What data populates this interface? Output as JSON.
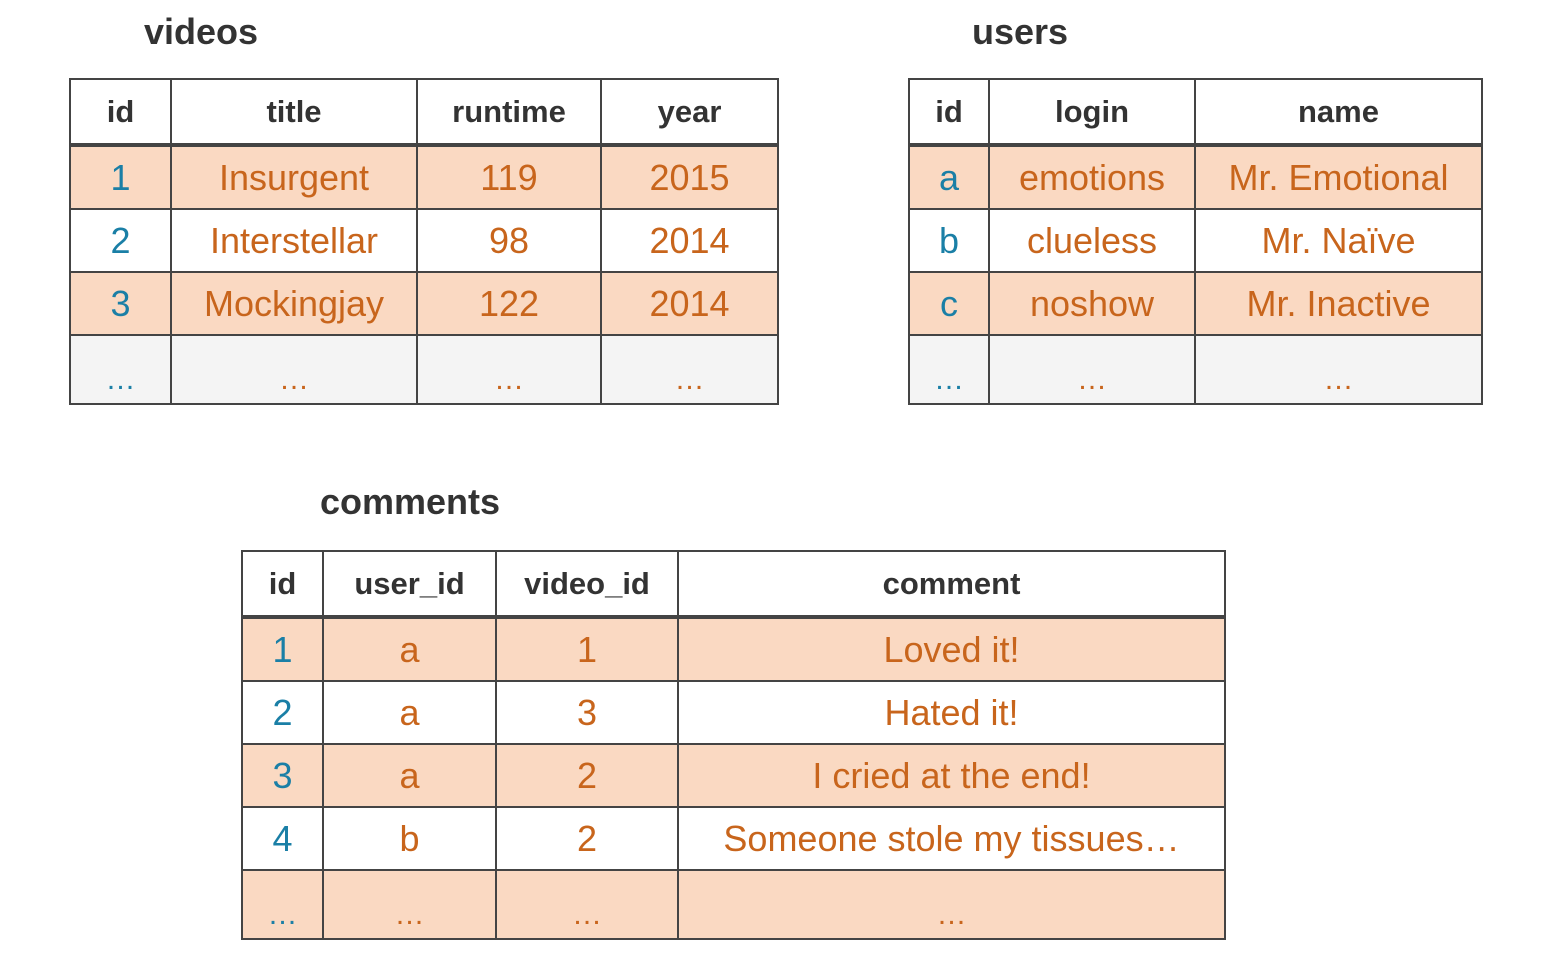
{
  "videos": {
    "title": "videos",
    "columns": [
      "id",
      "title",
      "runtime",
      "year"
    ],
    "rows": [
      [
        "1",
        "Insurgent",
        "119",
        "2015"
      ],
      [
        "2",
        "Interstellar",
        "98",
        "2014"
      ],
      [
        "3",
        "Mockingjay",
        "122",
        "2014"
      ],
      [
        "…",
        "…",
        "…",
        "…"
      ]
    ]
  },
  "users": {
    "title": "users",
    "columns": [
      "id",
      "login",
      "name"
    ],
    "rows": [
      [
        "a",
        "emotions",
        "Mr. Emotional"
      ],
      [
        "b",
        "clueless",
        "Mr. Naïve"
      ],
      [
        "c",
        "noshow",
        "Mr. Inactive"
      ],
      [
        "…",
        "…",
        "…"
      ]
    ]
  },
  "comments": {
    "title": "comments",
    "columns": [
      "id",
      "user_id",
      "video_id",
      "comment"
    ],
    "rows": [
      [
        "1",
        "a",
        "1",
        "Loved it!"
      ],
      [
        "2",
        "a",
        "3",
        "Hated it!"
      ],
      [
        "3",
        "a",
        "2",
        "I cried at the end!"
      ],
      [
        "4",
        "b",
        "2",
        "Someone stole my tissues…"
      ],
      [
        "…",
        "…",
        "…",
        "…"
      ]
    ]
  },
  "colors": {
    "header_text": "#333333",
    "id_text": "#1a7fa6",
    "value_text": "#c8651c",
    "shaded_row": "#fad9c2",
    "border": "#444444"
  }
}
